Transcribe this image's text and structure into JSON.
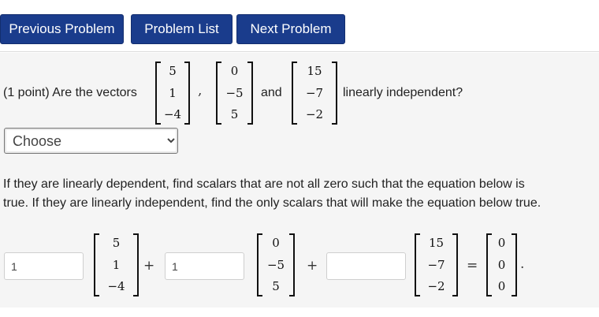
{
  "nav": {
    "previous_label": "Previous Problem",
    "list_label": "Problem List",
    "next_label": "Next Problem"
  },
  "question": {
    "prefix": "(1 point) Are the vectors",
    "comma": ",",
    "and": "and",
    "suffix": "linearly independent?",
    "vectors": [
      [
        "5",
        "1",
        "−4"
      ],
      [
        "0",
        "−5",
        "5"
      ],
      [
        "15",
        "−7",
        "−2"
      ]
    ]
  },
  "dropdown": {
    "selected": "Choose",
    "options": [
      "Choose"
    ]
  },
  "instructions": {
    "line1": "If they are linearly dependent, find scalars that are not all zero such that the equation below is",
    "line2": "true. If they are linearly independent, find the only scalars that will make the equation below true."
  },
  "equation": {
    "scalar_values": [
      "1",
      "1"
    ],
    "plus": "+",
    "equals": "=",
    "period": ".",
    "vectors": [
      [
        "5",
        "1",
        "−4"
      ],
      [
        "0",
        "−5",
        "5"
      ],
      [
        "15",
        "−7",
        "−2"
      ],
      [
        "0",
        "0",
        "0"
      ]
    ]
  }
}
